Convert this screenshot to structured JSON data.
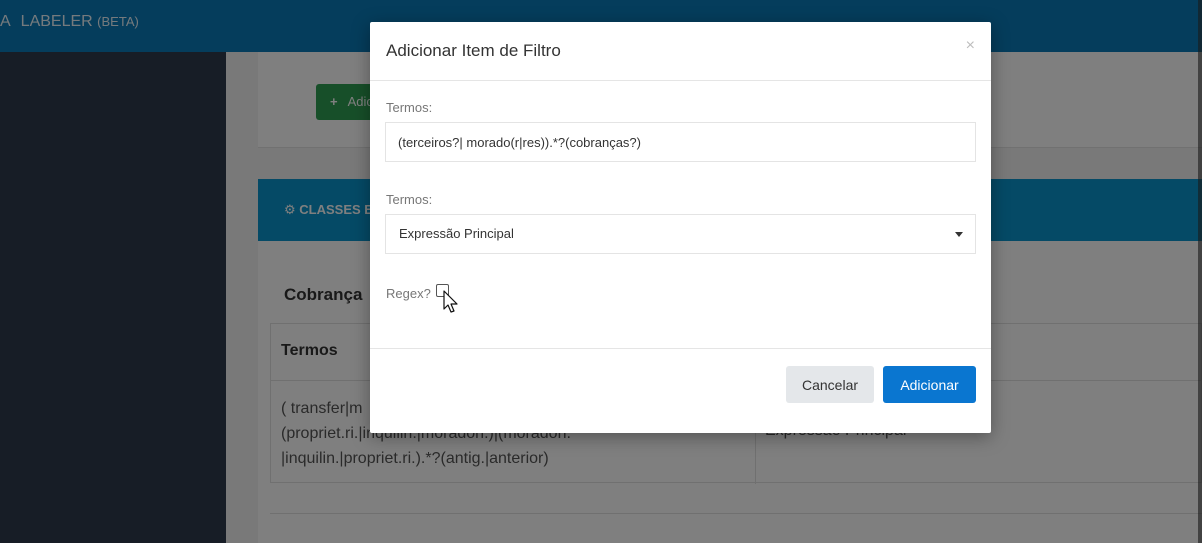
{
  "app": {
    "brand_prefix": "A",
    "brand_name": "LABELER",
    "brand_suffix": "(BETA)"
  },
  "background": {
    "add_button_label": "Adicio",
    "classes_header_label": "CLASSES E",
    "section_title": "Cobrança",
    "table": {
      "header_terms": "Termos",
      "row_terms_lines": [
        "( transfer|m",
        "(propriet.ri.|inquilin.|moradon.)|(moradon.",
        "|inquilin.|propriet.ri.).*?(antig.|anterior)"
      ],
      "row_expression": "Expressão Principal"
    }
  },
  "modal": {
    "title": "Adicionar Item de Filtro",
    "close_glyph": "×",
    "terms_label": "Termos:",
    "terms_value": "(terceiros?| morado(r|res)).*?(cobranças?)",
    "type_label": "Termos:",
    "type_selected": "Expressão Principal",
    "regex_label": "Regex?",
    "regex_checked": false,
    "cancel_label": "Cancelar",
    "submit_label": "Adicionar"
  },
  "colors": {
    "topbar": "#0b7ab8",
    "sidebar": "#2e3a4c",
    "add_button": "#2e9e52",
    "classes_header": "#0b95cc",
    "primary_button": "#0a76d0"
  }
}
